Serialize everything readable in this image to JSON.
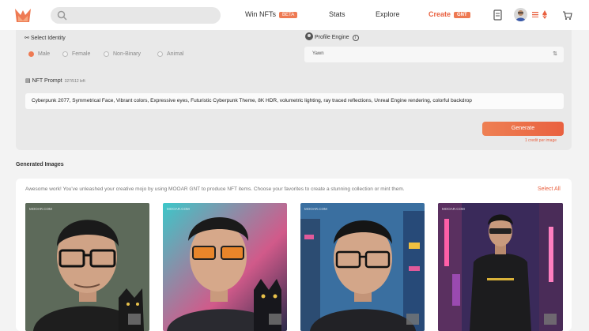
{
  "nav": {
    "win_nfts": "Win NFTs",
    "win_badge": "BETA",
    "stats": "Stats",
    "explore": "Explore",
    "create": "Create",
    "create_badge": "GNT"
  },
  "form": {
    "identity_label": "Select Identity",
    "identity_options": [
      "Male",
      "Female",
      "Non-Binary",
      "Animal"
    ],
    "identity_selected": "Male",
    "engine_label": "Profile Engine",
    "engine_value": "Yawn",
    "prompt_label": "NFT Prompt",
    "prompt_count": "327/512 left",
    "prompt_value": "Cyberpunk 2077, Symmetrical Face, Vibrant colors, Expressive eyes, Futuristic Cyberpunk Theme, 8K HDR, volumetric lighting, ray traced reflections, Unreal Engine rendering, colorful backdrop",
    "generate_label": "Generate",
    "tiny_link": "1 credit per image"
  },
  "gallery": {
    "title": "Generated Images",
    "message": "Awesome work! You've unleashed your creative mojo by using MOOAR GNT to produce NFT items. Choose your favorites to create a stunning collection or mint them.",
    "select_all": "Select All",
    "watermark": "MOOAR.COM",
    "brand": "MOOAR"
  },
  "colors": {
    "accent": "#e9603f",
    "accent_light": "#ee8053"
  }
}
